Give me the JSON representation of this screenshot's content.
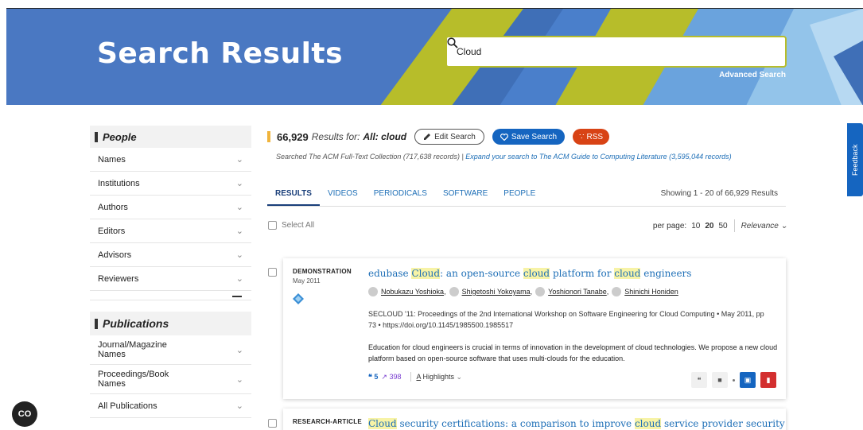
{
  "banner": {
    "title": "Search Results",
    "advanced_search": "Advanced Search"
  },
  "search": {
    "value": "Cloud",
    "placeholder": ""
  },
  "sidebar": {
    "people_heading": "People",
    "people_items": [
      {
        "label": "Names"
      },
      {
        "label": "Institutions"
      },
      {
        "label": "Authors"
      },
      {
        "label": "Editors"
      },
      {
        "label": "Advisors"
      },
      {
        "label": "Reviewers"
      }
    ],
    "publications_heading": "Publications",
    "publication_items": [
      {
        "label": "Journal/Magazine Names"
      },
      {
        "label": "Proceedings/Book Names"
      },
      {
        "label": "All Publications"
      }
    ]
  },
  "results": {
    "count": "66,929",
    "results_for": "Results for:",
    "query": "All: cloud",
    "edit_search": "Edit Search",
    "save_search": "Save Search",
    "rss": "RSS",
    "searched_text": "Searched The ACM Full-Text Collection (717,638 records) |",
    "expand_link": "Expand your search to The ACM Guide to Computing Literature (3,595,044 records)"
  },
  "tabs": [
    {
      "label": "RESULTS",
      "active": true
    },
    {
      "label": "VIDEOS"
    },
    {
      "label": "PERIODICALS"
    },
    {
      "label": "SOFTWARE"
    },
    {
      "label": "PEOPLE"
    }
  ],
  "showing": "Showing 1 - 20 of 66,929 Results",
  "select_all": "Select All",
  "per_page": {
    "label": "per page:",
    "options": [
      "10",
      "20",
      "50"
    ],
    "selected": "20",
    "sort": "Relevance"
  },
  "result1": {
    "type": "DEMONSTRATION",
    "date": "May 2011",
    "title_parts": [
      "edubase ",
      "Cloud",
      ": an open-source ",
      "cloud",
      " platform for ",
      "cloud",
      " engineers"
    ],
    "authors": [
      "Nobukazu Yoshioka",
      "Shigetoshi Yokoyama",
      "Yoshionori Tanabe",
      "Shinichi Honiden"
    ],
    "venue": "SECLOUD '11: Proceedings of the 2nd International Workshop on Software Engineering for Cloud Computing • May 2011, pp 73 • https://doi.org/10.1145/1985500.1985517",
    "description": "Education for cloud engineers is crucial in terms of innovation in the development of cloud technologies. We propose a new cloud platform based on open-source software that uses multi-clouds for the education.",
    "citations": "5",
    "downloads": "398",
    "highlights": "Highlights"
  },
  "result2": {
    "type": "RESEARCH-ARTICLE",
    "title_parts": [
      "Cloud",
      " security certifications: a comparison to improve ",
      "cloud",
      " service provider security"
    ]
  },
  "feedback": "Feedback",
  "cookie": "CO",
  "colors": {
    "banner": "#4a78c2",
    "accent_yellow": "#b7bd2a",
    "link": "#1e6fb7",
    "save": "#1565c0",
    "rss": "#d84315"
  }
}
